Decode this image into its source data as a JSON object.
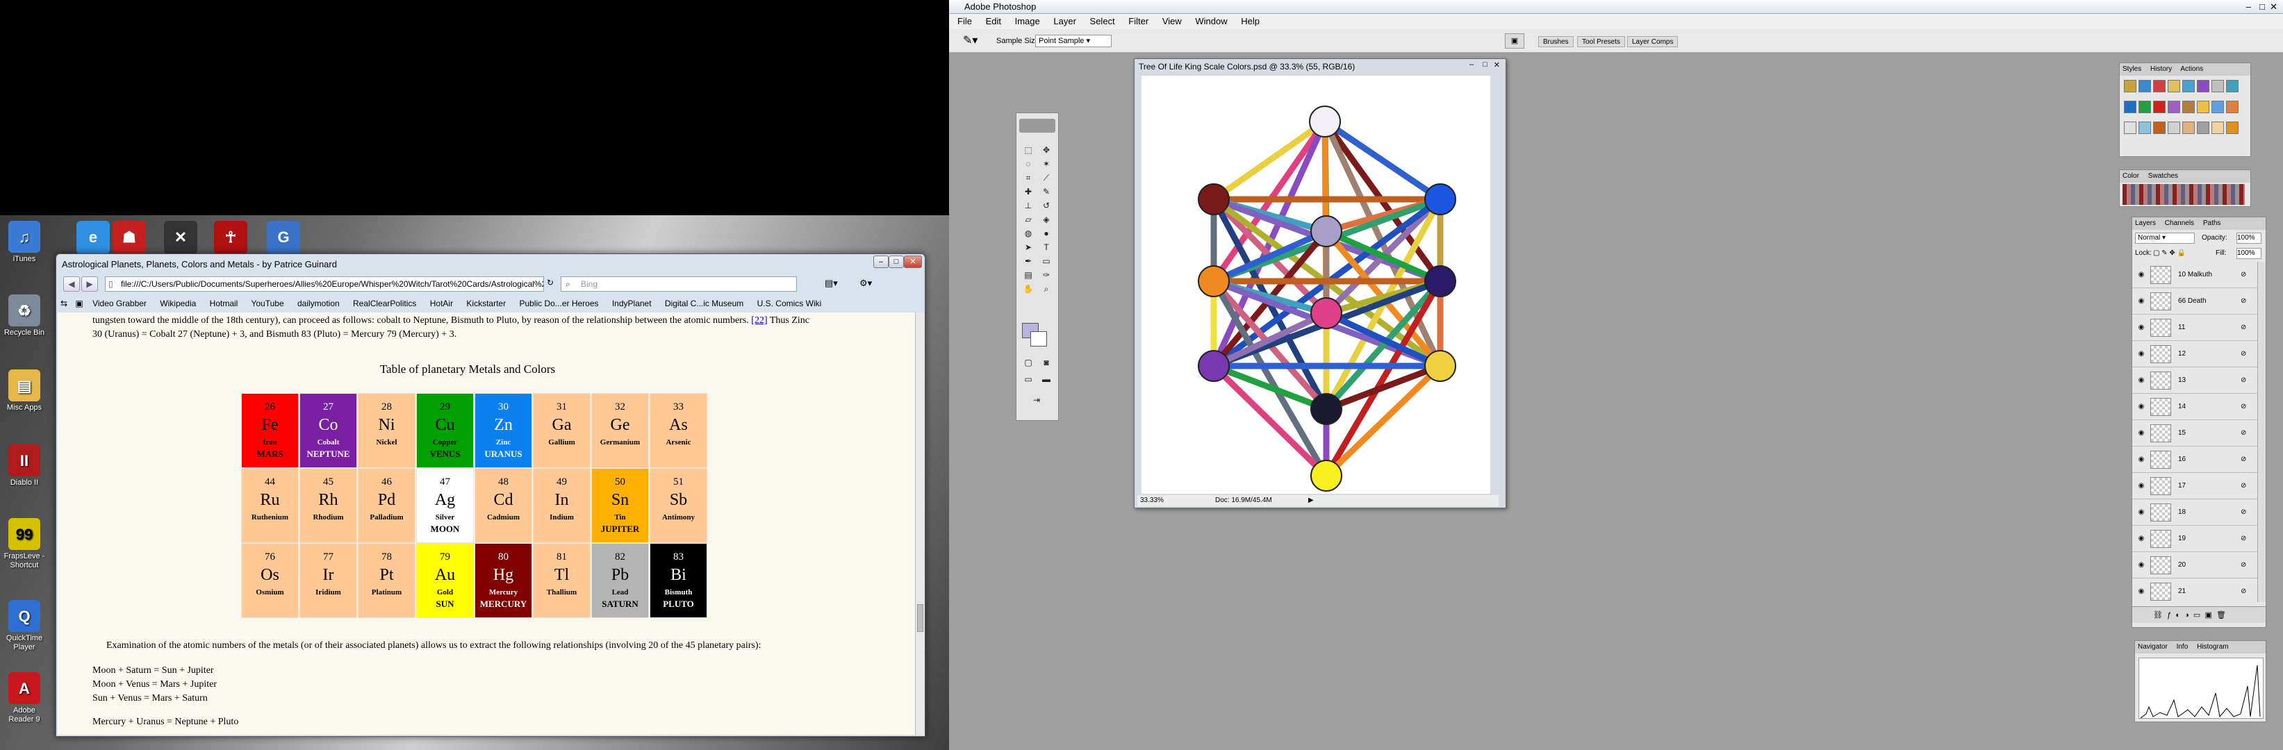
{
  "desktop": {
    "icons": [
      {
        "label": "iTunes",
        "icon": "itunes-icon",
        "color": "#3a7bd5"
      },
      {
        "label": "Recycle Bin",
        "icon": "recycle-bin-icon",
        "color": "#7d8a99"
      },
      {
        "label": "Misc Apps",
        "icon": "folder-icon",
        "color": "#e6b84a"
      },
      {
        "label": "Diablo II",
        "icon": "diablo-icon",
        "color": "#b01c1c"
      },
      {
        "label": "FrapsLeve - Shortcut",
        "icon": "fraps-icon",
        "color": "#d4c200"
      },
      {
        "label": "QuickTime Player",
        "icon": "quicktime-icon",
        "color": "#2f6fd0"
      },
      {
        "label": "Adobe Reader 9",
        "icon": "adobe-reader-icon",
        "color": "#c8171e"
      }
    ],
    "quicklaunch": [
      {
        "icon": "browser-icon",
        "color": "#2f8fe0"
      },
      {
        "icon": "figures-icon",
        "color": "#c52020"
      },
      {
        "icon": "xbox-icon",
        "color": "#333333"
      },
      {
        "icon": "red-figure-icon",
        "color": "#b01010"
      },
      {
        "icon": "g-app-icon",
        "color": "#3a72c8"
      }
    ]
  },
  "browser": {
    "title": "Astrological Planets, Planets, Colors and Metals - by Patrice Guinard",
    "url": "file:///C:/Users/Public/Documents/Superheroes/Allies%20Europe/Whisper%20Witch/Tarot%20Cards/Astrological%20Planet",
    "search_placeholder": "Bing",
    "bookmarks": [
      "Video Grabber",
      "Wikipedia",
      "Hotmail",
      "YouTube",
      "dailymotion",
      "RealClearPolitics",
      "HotAir",
      "Kickstarter",
      "Public Do...er Heroes",
      "IndyPlanet",
      "Digital C...ic Museum",
      "U.S. Comics Wiki"
    ],
    "content": {
      "intro_line1": "tungsten toward the middle of the 18th century), can proceed as follows: cobalt to Neptune, Bismuth to Pluto, by reason of the relationship between the atomic numbers.",
      "footnote": "[22]",
      "intro_line1_tail": "Thus Zinc",
      "intro_line2": "30 (Uranus) = Cobalt 27 (Neptune) + 3, and Bismuth 83 (Pluto) = Mercury 79 (Mercury) + 3.",
      "table_title": "Table of planetary Metals and Colors",
      "paragraph": "Examination of the atomic numbers of the metals (or of their associated planets) allows us to extract the following relationships (involving 20 of the 45 planetary pairs):",
      "relations": [
        "Moon + Saturn = Sun + Jupiter",
        "Moon + Venus = Mars + Jupiter",
        "Sun + Venus = Mars + Saturn",
        "Mercury + Uranus = Neptune + Pluto"
      ]
    },
    "elements": [
      [
        {
          "num": "26",
          "sym": "Fe",
          "name": "Iron",
          "planet": "MARS",
          "bg": "#ff0000",
          "fg": "#000000"
        },
        {
          "num": "27",
          "sym": "Co",
          "name": "Cobalt",
          "planet": "NEPTUNE",
          "bg": "#7a1fa2",
          "fg": "#ffffff"
        },
        {
          "num": "28",
          "sym": "Ni",
          "name": "Nickel",
          "planet": "",
          "bg": "#ffc894",
          "fg": "#000000"
        },
        {
          "num": "29",
          "sym": "Cu",
          "name": "Copper",
          "planet": "VENUS",
          "bg": "#00a000",
          "fg": "#000000"
        },
        {
          "num": "30",
          "sym": "Zn",
          "name": "Zinc",
          "planet": "URANUS",
          "bg": "#0b80f0",
          "fg": "#ffffff"
        },
        {
          "num": "31",
          "sym": "Ga",
          "name": "Gallium",
          "planet": "",
          "bg": "#ffc894",
          "fg": "#000000"
        },
        {
          "num": "32",
          "sym": "Ge",
          "name": "Germanium",
          "planet": "",
          "bg": "#ffc894",
          "fg": "#000000"
        },
        {
          "num": "33",
          "sym": "As",
          "name": "Arsenic",
          "planet": "",
          "bg": "#ffc894",
          "fg": "#000000"
        }
      ],
      [
        {
          "num": "44",
          "sym": "Ru",
          "name": "Ruthenium",
          "planet": "",
          "bg": "#ffc894",
          "fg": "#000000"
        },
        {
          "num": "45",
          "sym": "Rh",
          "name": "Rhodium",
          "planet": "",
          "bg": "#ffc894",
          "fg": "#000000"
        },
        {
          "num": "46",
          "sym": "Pd",
          "name": "Palladium",
          "planet": "",
          "bg": "#ffc894",
          "fg": "#000000"
        },
        {
          "num": "47",
          "sym": "Ag",
          "name": "Silver",
          "planet": "MOON",
          "bg": "#ffffff",
          "fg": "#000000"
        },
        {
          "num": "48",
          "sym": "Cd",
          "name": "Cadmium",
          "planet": "",
          "bg": "#ffc894",
          "fg": "#000000"
        },
        {
          "num": "49",
          "sym": "In",
          "name": "Indium",
          "planet": "",
          "bg": "#ffc894",
          "fg": "#000000"
        },
        {
          "num": "50",
          "sym": "Sn",
          "name": "Tin",
          "planet": "JUPITER",
          "bg": "#ffb000",
          "fg": "#000000"
        },
        {
          "num": "51",
          "sym": "Sb",
          "name": "Antimony",
          "planet": "",
          "bg": "#ffc894",
          "fg": "#000000"
        }
      ],
      [
        {
          "num": "76",
          "sym": "Os",
          "name": "Osmium",
          "planet": "",
          "bg": "#ffc894",
          "fg": "#000000"
        },
        {
          "num": "77",
          "sym": "Ir",
          "name": "Iridium",
          "planet": "",
          "bg": "#ffc894",
          "fg": "#000000"
        },
        {
          "num": "78",
          "sym": "Pt",
          "name": "Platinum",
          "planet": "",
          "bg": "#ffc894",
          "fg": "#000000"
        },
        {
          "num": "79",
          "sym": "Au",
          "name": "Gold",
          "planet": "SUN",
          "bg": "#ffff00",
          "fg": "#000000"
        },
        {
          "num": "80",
          "sym": "Hg",
          "name": "Mercury",
          "planet": "MERCURY",
          "bg": "#800000",
          "fg": "#ffffff"
        },
        {
          "num": "81",
          "sym": "Tl",
          "name": "Thallium",
          "planet": "",
          "bg": "#ffc894",
          "fg": "#000000"
        },
        {
          "num": "82",
          "sym": "Pb",
          "name": "Lead",
          "planet": "SATURN",
          "bg": "#b4b4b4",
          "fg": "#000000"
        },
        {
          "num": "83",
          "sym": "Bi",
          "name": "Bismuth",
          "planet": "PLUTO",
          "bg": "#000000",
          "fg": "#ffffff"
        }
      ]
    ]
  },
  "photoshop": {
    "app_title": "Adobe Photoshop",
    "menu": [
      "File",
      "Edit",
      "Image",
      "Layer",
      "Select",
      "Filter",
      "View",
      "Window",
      "Help"
    ],
    "sample_size_label": "Sample Size:",
    "sample_size_value": "Point Sample",
    "panel_tabs": [
      "Brushes",
      "Tool Presets",
      "Layer Comps"
    ],
    "document": {
      "title": "Tree Of Life King Scale Colors.psd @ 33.3% (55, RGB/16)",
      "zoom": "33.33%",
      "doc_size": "Doc: 16.9M/45.4M"
    },
    "styles_tabs": [
      "Styles",
      "History",
      "Actions"
    ],
    "color_tabs": [
      "Color",
      "Swatches"
    ],
    "layers_tabs": [
      "Layers",
      "Channels",
      "Paths"
    ],
    "blend_mode": "Normal",
    "opacity_label": "Opacity:",
    "opacity_value": "100%",
    "lock_label": "Lock:",
    "fill_label": "Fill:",
    "fill_value": "100%",
    "layers": [
      "10 Malkuth",
      "66 Death",
      "11",
      "12",
      "13",
      "14",
      "15",
      "16",
      "17",
      "18",
      "19",
      "20",
      "21"
    ],
    "nav_tabs": [
      "Navigator",
      "Info",
      "Histogram"
    ],
    "sephirot_colors": [
      "#f5f0f8",
      "#7a1a1a",
      "#1a56e0",
      "#a8a0c8",
      "#f08a20",
      "#2a1a6a",
      "#e0408a",
      "#7a38b0",
      "#f0d040",
      "#1a1a30",
      "#f8f020"
    ]
  }
}
